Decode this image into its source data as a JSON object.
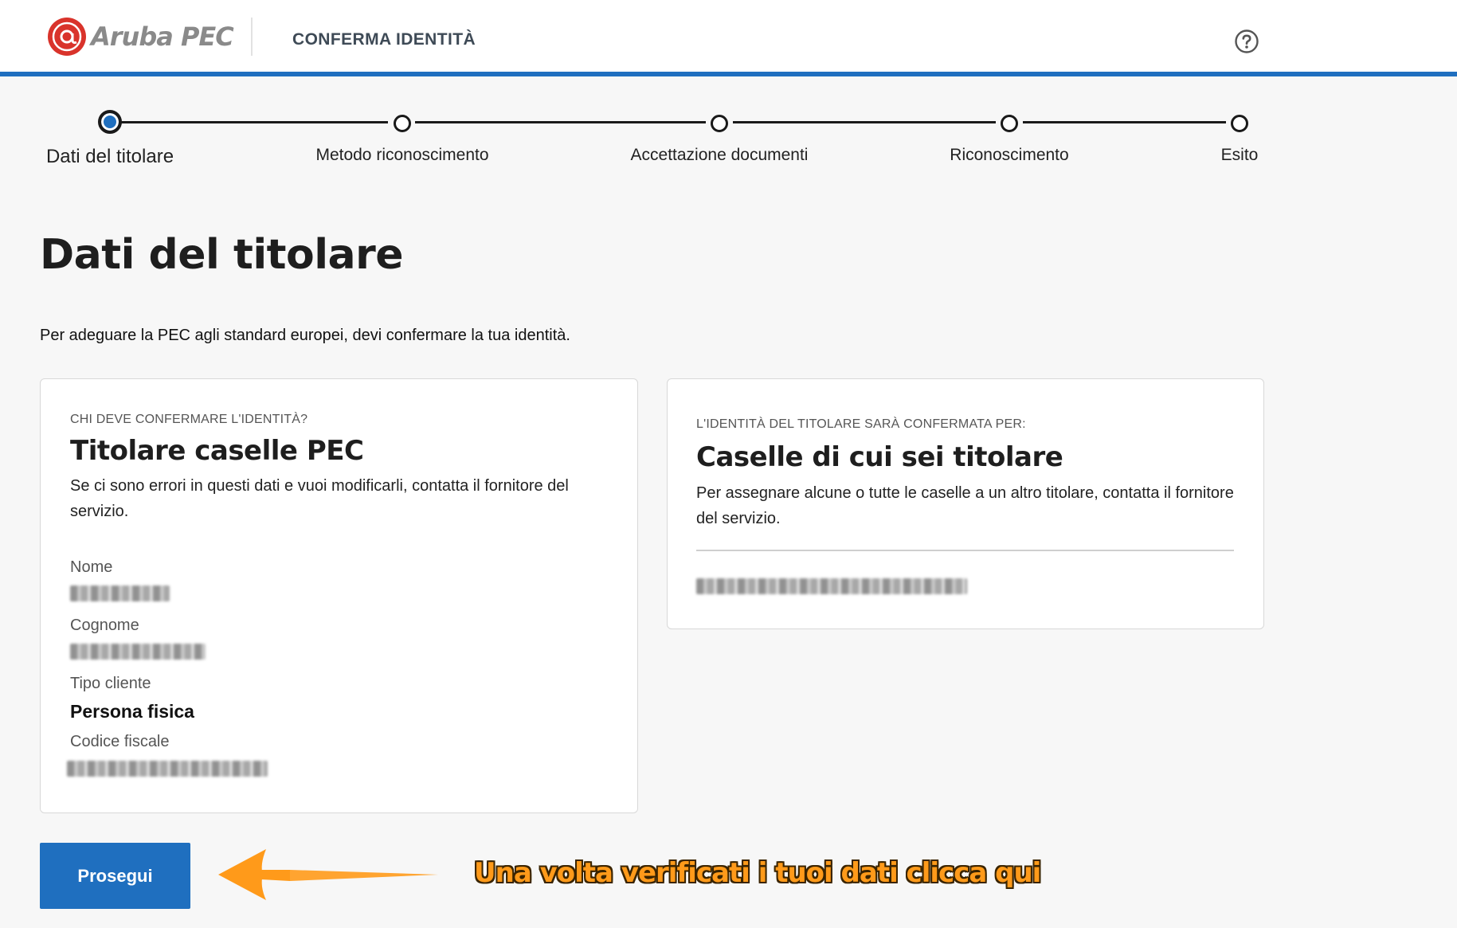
{
  "header": {
    "brand": "Aruba PEC",
    "title": "CONFERMA IDENTITÀ",
    "help_icon": "question-circle-icon"
  },
  "stepper": {
    "active_index": 0,
    "steps": [
      {
        "label": "Dati del titolare"
      },
      {
        "label": "Metodo riconoscimento"
      },
      {
        "label": "Accettazione documenti"
      },
      {
        "label": "Riconoscimento"
      },
      {
        "label": "Esito"
      }
    ]
  },
  "main": {
    "title": "Dati del titolare",
    "intro": "Per adeguare la PEC agli standard europei, devi confermare la tua identità."
  },
  "holder_card": {
    "eyebrow": "CHI DEVE CONFERMARE L'IDENTITÀ?",
    "title": "Titolare caselle PEC",
    "text": "Se ci sono errori in questi dati e vuoi modificarli, contatta il fornitore del servizio.",
    "fields": {
      "name_label": "Nome",
      "surname_label": "Cognome",
      "client_type_label": "Tipo cliente",
      "client_type_value": "Persona fisica",
      "tax_code_label": "Codice fiscale"
    }
  },
  "mailbox_card": {
    "eyebrow": "L'IDENTITÀ DEL TITOLARE SARÀ CONFERMATA PER:",
    "title": "Caselle di cui sei titolare",
    "text": "Per assegnare alcune o tutte le caselle a un altro titolare, contatta il fornitore del servizio."
  },
  "actions": {
    "continue_label": "Prosegui"
  },
  "annotation": {
    "text": "Una volta verificati i tuoi dati clicca qui"
  },
  "colors": {
    "accent": "#1f6fbf",
    "annotation": "#ff9a1a",
    "brand_red": "#d9332b"
  }
}
